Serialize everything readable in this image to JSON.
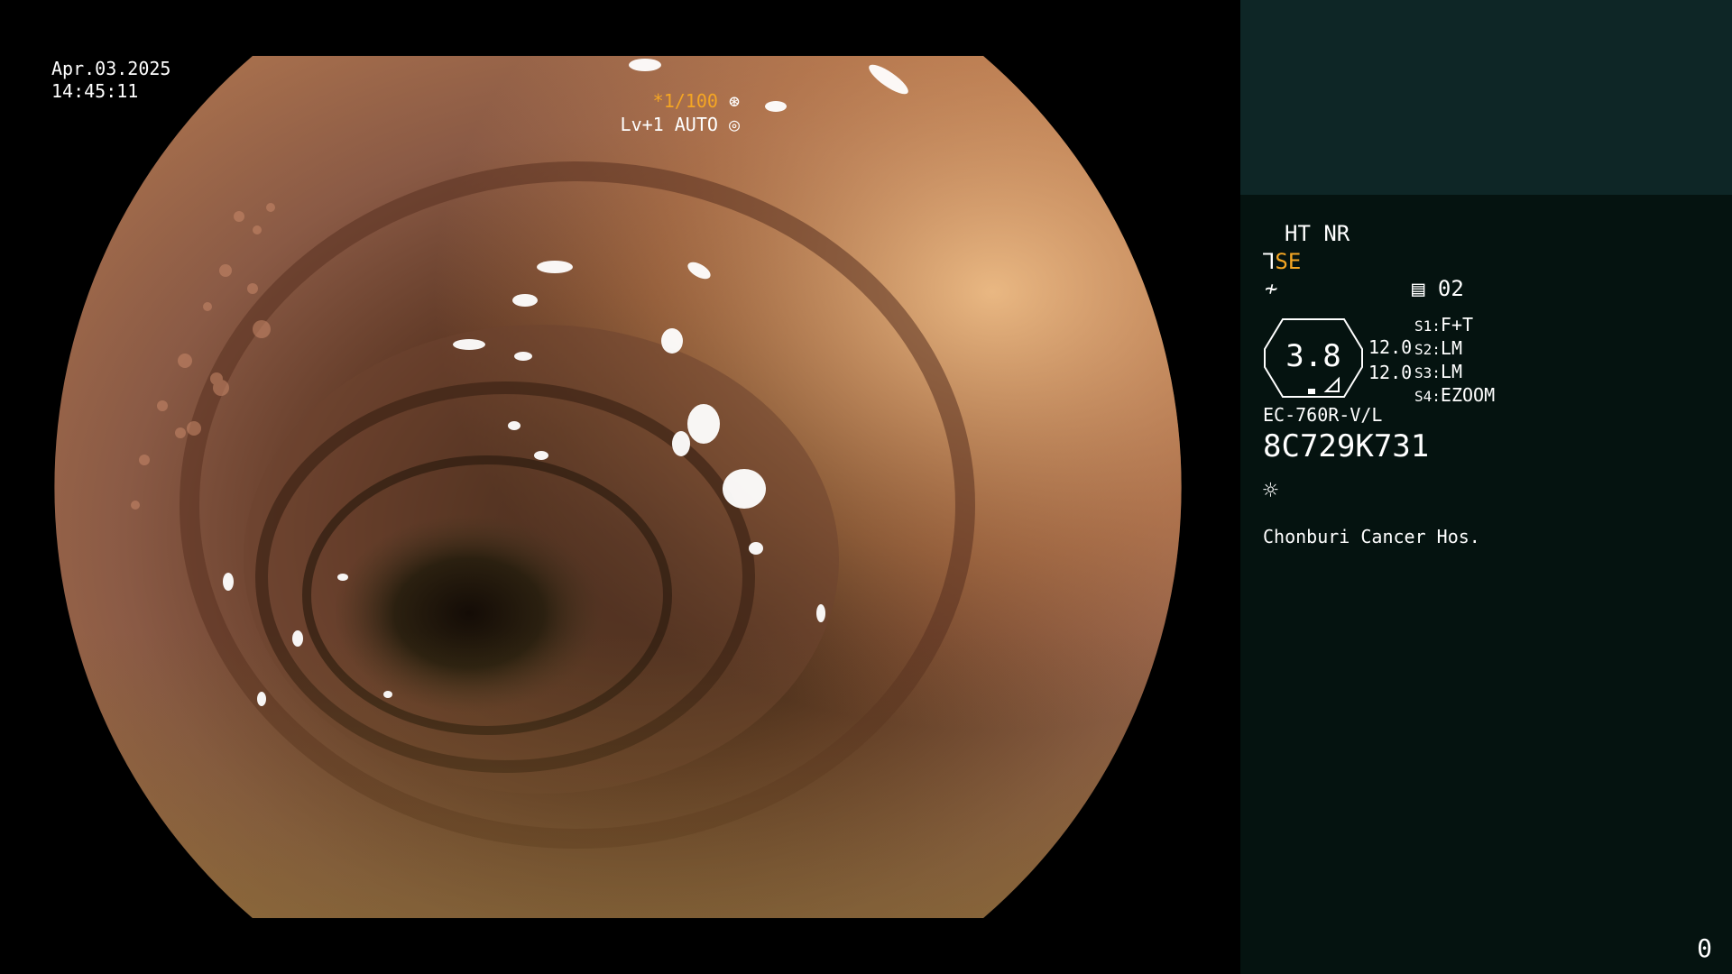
{
  "overlay": {
    "date": "Apr.03.2025",
    "time": "14:45:11",
    "shutter": "*1/100",
    "level": "Lv+1 AUTO"
  },
  "sidebar": {
    "mode": "HT NR",
    "se": "SE",
    "channel": "02",
    "zoom_value": "3.8",
    "value1": "12.0",
    "value2": "12.0",
    "s1_key": "S1:",
    "s1_val": "F+T",
    "s2_key": "S2:",
    "s2_val": "LM",
    "s3_key": "S3:",
    "s3_val": "LM",
    "s4_key": "S4:",
    "s4_val": "EZOOM",
    "scope_model": "EC-760R-V/L",
    "serial": "8C729K731",
    "hospital": "Chonburi Cancer Hos.",
    "counter": "0"
  },
  "colors": {
    "accent": "#f5a623",
    "sidebar_bg": "#051310",
    "sidebar_top_bg": "#0e2626"
  },
  "icons": {
    "shutter_icon": "aperture-icon",
    "level_icon": "iris-icon",
    "se_icon": "scope-icon",
    "enhance_icon": "curve-icon",
    "channel_icon": "memory-icon",
    "light_icon": "sun-icon"
  }
}
